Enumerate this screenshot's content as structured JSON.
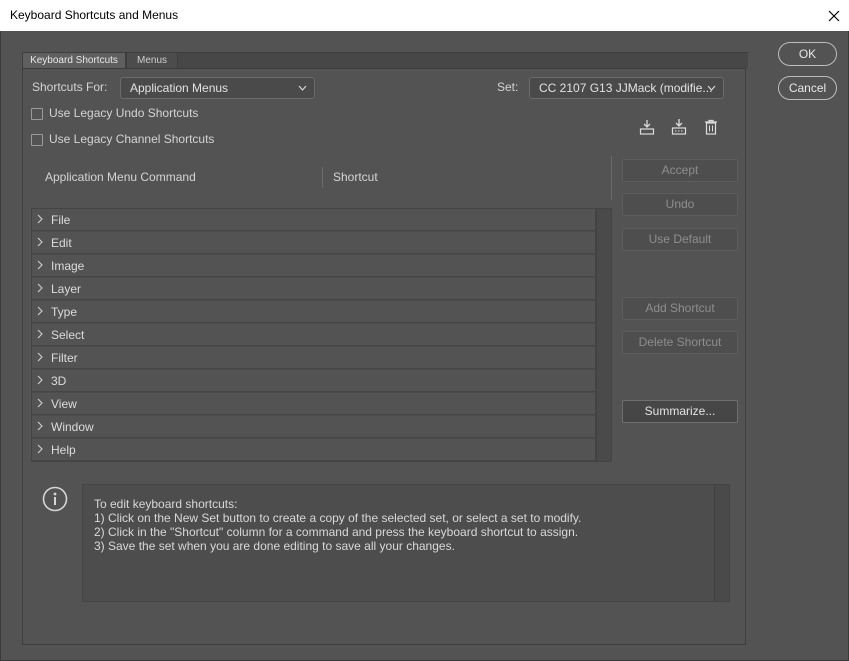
{
  "window": {
    "title": "Keyboard Shortcuts and Menus"
  },
  "tabs": [
    {
      "label": "Keyboard Shortcuts",
      "active": true
    },
    {
      "label": "Menus",
      "active": false
    }
  ],
  "shortcuts_for": {
    "label": "Shortcuts For:",
    "value": "Application Menus"
  },
  "set": {
    "label": "Set:",
    "value": "CC 2107 G13 JJMack (modifie..."
  },
  "options": {
    "legacy_undo": {
      "label": "Use Legacy Undo Shortcuts",
      "checked": false
    },
    "legacy_channel": {
      "label": "Use Legacy Channel Shortcuts",
      "checked": false
    }
  },
  "set_icons": [
    "save-set-icon",
    "new-set-icon",
    "delete-set-icon"
  ],
  "table": {
    "col_command": "Application Menu Command",
    "col_shortcut": "Shortcut",
    "rows": [
      "File",
      "Edit",
      "Image",
      "Layer",
      "Type",
      "Select",
      "Filter",
      "3D",
      "View",
      "Window",
      "Help"
    ]
  },
  "side_buttons": {
    "accept": "Accept",
    "undo": "Undo",
    "use_default": "Use Default",
    "add_shortcut": "Add Shortcut",
    "delete_shortcut": "Delete Shortcut",
    "summarize": "Summarize..."
  },
  "dialog_buttons": {
    "ok": "OK",
    "cancel": "Cancel"
  },
  "info": {
    "lines": [
      "To edit keyboard shortcuts:",
      "1) Click on the New Set button to create a copy of the selected set, or select a set to modify.",
      "2) Click in the \"Shortcut\" column for a command and press the keyboard shortcut to assign.",
      "3) Save the set when you are done editing to save all your changes."
    ]
  }
}
